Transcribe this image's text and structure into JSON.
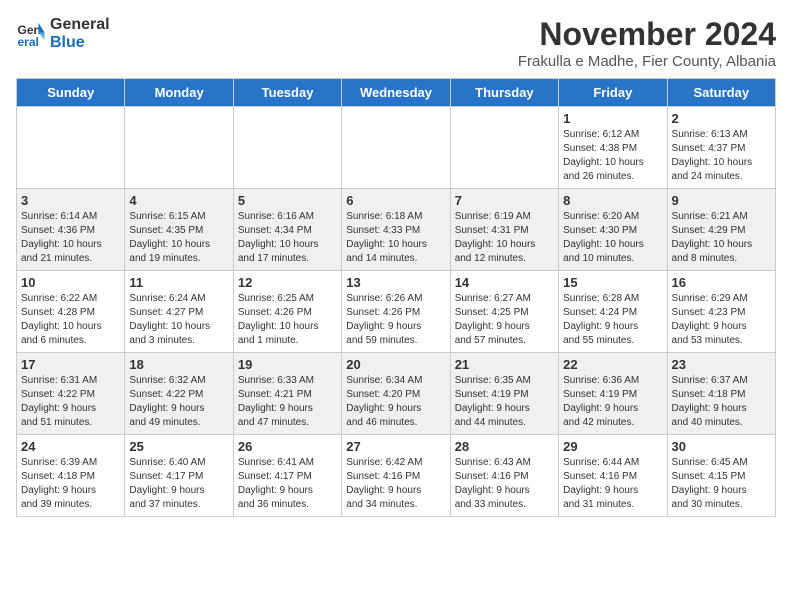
{
  "logo": {
    "line1": "General",
    "line2": "Blue"
  },
  "title": "November 2024",
  "location": "Frakulla e Madhe, Fier County, Albania",
  "weekdays": [
    "Sunday",
    "Monday",
    "Tuesday",
    "Wednesday",
    "Thursday",
    "Friday",
    "Saturday"
  ],
  "weeks": [
    [
      {
        "day": "",
        "info": ""
      },
      {
        "day": "",
        "info": ""
      },
      {
        "day": "",
        "info": ""
      },
      {
        "day": "",
        "info": ""
      },
      {
        "day": "",
        "info": ""
      },
      {
        "day": "1",
        "info": "Sunrise: 6:12 AM\nSunset: 4:38 PM\nDaylight: 10 hours\nand 26 minutes."
      },
      {
        "day": "2",
        "info": "Sunrise: 6:13 AM\nSunset: 4:37 PM\nDaylight: 10 hours\nand 24 minutes."
      }
    ],
    [
      {
        "day": "3",
        "info": "Sunrise: 6:14 AM\nSunset: 4:36 PM\nDaylight: 10 hours\nand 21 minutes."
      },
      {
        "day": "4",
        "info": "Sunrise: 6:15 AM\nSunset: 4:35 PM\nDaylight: 10 hours\nand 19 minutes."
      },
      {
        "day": "5",
        "info": "Sunrise: 6:16 AM\nSunset: 4:34 PM\nDaylight: 10 hours\nand 17 minutes."
      },
      {
        "day": "6",
        "info": "Sunrise: 6:18 AM\nSunset: 4:33 PM\nDaylight: 10 hours\nand 14 minutes."
      },
      {
        "day": "7",
        "info": "Sunrise: 6:19 AM\nSunset: 4:31 PM\nDaylight: 10 hours\nand 12 minutes."
      },
      {
        "day": "8",
        "info": "Sunrise: 6:20 AM\nSunset: 4:30 PM\nDaylight: 10 hours\nand 10 minutes."
      },
      {
        "day": "9",
        "info": "Sunrise: 6:21 AM\nSunset: 4:29 PM\nDaylight: 10 hours\nand 8 minutes."
      }
    ],
    [
      {
        "day": "10",
        "info": "Sunrise: 6:22 AM\nSunset: 4:28 PM\nDaylight: 10 hours\nand 6 minutes."
      },
      {
        "day": "11",
        "info": "Sunrise: 6:24 AM\nSunset: 4:27 PM\nDaylight: 10 hours\nand 3 minutes."
      },
      {
        "day": "12",
        "info": "Sunrise: 6:25 AM\nSunset: 4:26 PM\nDaylight: 10 hours\nand 1 minute."
      },
      {
        "day": "13",
        "info": "Sunrise: 6:26 AM\nSunset: 4:26 PM\nDaylight: 9 hours\nand 59 minutes."
      },
      {
        "day": "14",
        "info": "Sunrise: 6:27 AM\nSunset: 4:25 PM\nDaylight: 9 hours\nand 57 minutes."
      },
      {
        "day": "15",
        "info": "Sunrise: 6:28 AM\nSunset: 4:24 PM\nDaylight: 9 hours\nand 55 minutes."
      },
      {
        "day": "16",
        "info": "Sunrise: 6:29 AM\nSunset: 4:23 PM\nDaylight: 9 hours\nand 53 minutes."
      }
    ],
    [
      {
        "day": "17",
        "info": "Sunrise: 6:31 AM\nSunset: 4:22 PM\nDaylight: 9 hours\nand 51 minutes."
      },
      {
        "day": "18",
        "info": "Sunrise: 6:32 AM\nSunset: 4:22 PM\nDaylight: 9 hours\nand 49 minutes."
      },
      {
        "day": "19",
        "info": "Sunrise: 6:33 AM\nSunset: 4:21 PM\nDaylight: 9 hours\nand 47 minutes."
      },
      {
        "day": "20",
        "info": "Sunrise: 6:34 AM\nSunset: 4:20 PM\nDaylight: 9 hours\nand 46 minutes."
      },
      {
        "day": "21",
        "info": "Sunrise: 6:35 AM\nSunset: 4:19 PM\nDaylight: 9 hours\nand 44 minutes."
      },
      {
        "day": "22",
        "info": "Sunrise: 6:36 AM\nSunset: 4:19 PM\nDaylight: 9 hours\nand 42 minutes."
      },
      {
        "day": "23",
        "info": "Sunrise: 6:37 AM\nSunset: 4:18 PM\nDaylight: 9 hours\nand 40 minutes."
      }
    ],
    [
      {
        "day": "24",
        "info": "Sunrise: 6:39 AM\nSunset: 4:18 PM\nDaylight: 9 hours\nand 39 minutes."
      },
      {
        "day": "25",
        "info": "Sunrise: 6:40 AM\nSunset: 4:17 PM\nDaylight: 9 hours\nand 37 minutes."
      },
      {
        "day": "26",
        "info": "Sunrise: 6:41 AM\nSunset: 4:17 PM\nDaylight: 9 hours\nand 36 minutes."
      },
      {
        "day": "27",
        "info": "Sunrise: 6:42 AM\nSunset: 4:16 PM\nDaylight: 9 hours\nand 34 minutes."
      },
      {
        "day": "28",
        "info": "Sunrise: 6:43 AM\nSunset: 4:16 PM\nDaylight: 9 hours\nand 33 minutes."
      },
      {
        "day": "29",
        "info": "Sunrise: 6:44 AM\nSunset: 4:16 PM\nDaylight: 9 hours\nand 31 minutes."
      },
      {
        "day": "30",
        "info": "Sunrise: 6:45 AM\nSunset: 4:15 PM\nDaylight: 9 hours\nand 30 minutes."
      }
    ]
  ]
}
